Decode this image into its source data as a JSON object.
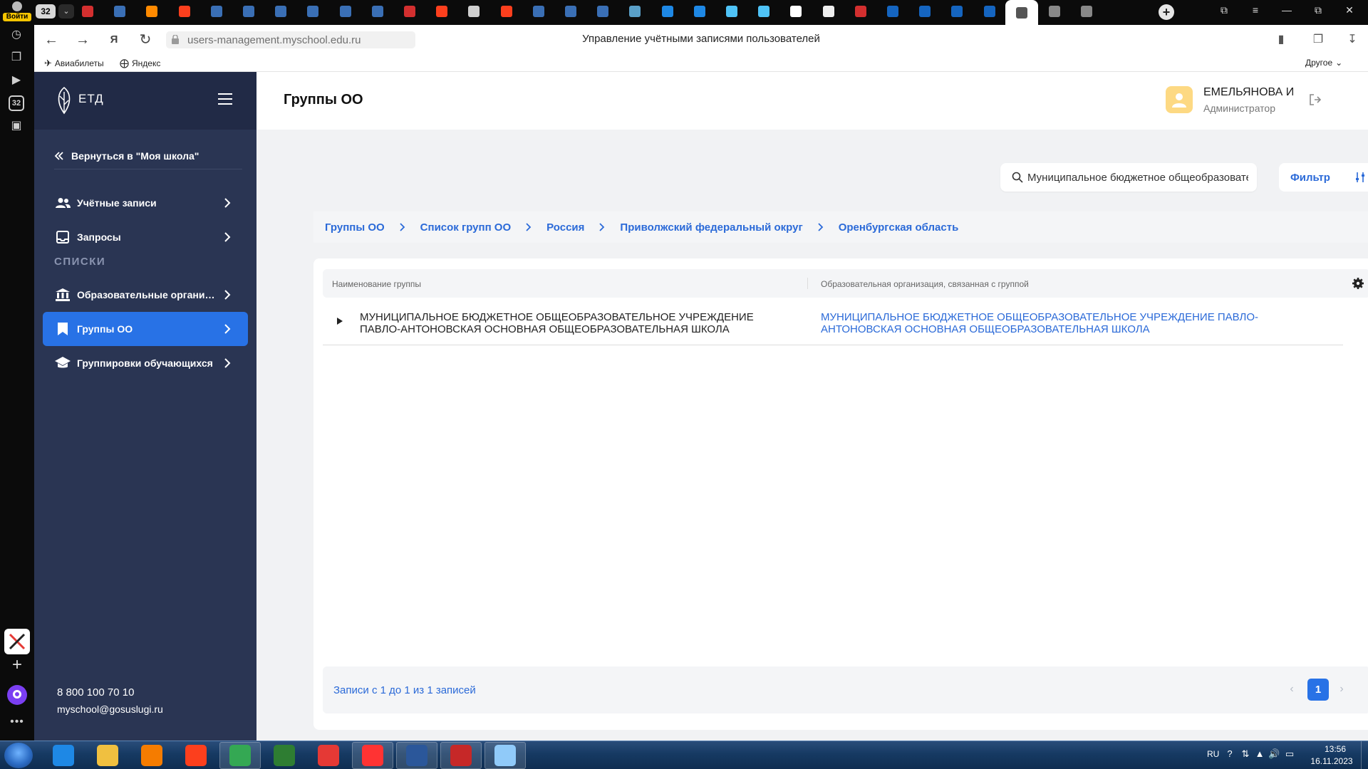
{
  "browser": {
    "login_label": "Войти",
    "tab_count": "32",
    "side_badge": "32",
    "tabs": [
      {
        "icon": "flag-ru-icon",
        "color": "#d32f2f"
      },
      {
        "icon": "emblem-icon",
        "color": "#3a6fb5"
      },
      {
        "icon": "cloud-icon",
        "color": "#ff8a00"
      },
      {
        "icon": "yandex-icon",
        "color": "#fc3f1d"
      },
      {
        "icon": "emblem-icon",
        "color": "#3a6fb5"
      },
      {
        "icon": "emblem-icon",
        "color": "#3a6fb5"
      },
      {
        "icon": "emblem-icon",
        "color": "#3a6fb5"
      },
      {
        "icon": "emblem-icon",
        "color": "#3a6fb5"
      },
      {
        "icon": "emblem-icon",
        "color": "#3a6fb5"
      },
      {
        "icon": "emblem-icon",
        "color": "#3a6fb5"
      },
      {
        "icon": "flag-ru-icon",
        "color": "#d32f2f"
      },
      {
        "icon": "yandex-icon",
        "color": "#fc3f1d"
      },
      {
        "icon": "signature-icon",
        "color": "#cfcfcf"
      },
      {
        "icon": "yandex-icon",
        "color": "#fc3f1d"
      },
      {
        "icon": "emblem-icon",
        "color": "#3a6fb5"
      },
      {
        "icon": "emblem-icon",
        "color": "#3a6fb5"
      },
      {
        "icon": "emblem-icon",
        "color": "#3a6fb5"
      },
      {
        "icon": "glasses-icon",
        "color": "#5aa0c8"
      },
      {
        "icon": "help-icon",
        "color": "#1e88e5"
      },
      {
        "icon": "help-icon",
        "color": "#1e88e5"
      },
      {
        "icon": "atom-icon",
        "color": "#4fc3f7"
      },
      {
        "icon": "atom-icon",
        "color": "#4fc3f7"
      },
      {
        "icon": "chat-icon",
        "color": "#ffffff"
      },
      {
        "icon": "document-icon",
        "color": "#eeeeee"
      },
      {
        "icon": "flag-ru-icon",
        "color": "#d32f2f"
      },
      {
        "icon": "mysh-icon",
        "color": "#1565c0"
      },
      {
        "icon": "mysh-icon",
        "color": "#1565c0"
      },
      {
        "icon": "mysh-icon",
        "color": "#1565c0"
      },
      {
        "icon": "mysh-icon",
        "color": "#1565c0"
      },
      {
        "icon": "etd-icon",
        "color": "#555555",
        "active": true
      },
      {
        "icon": "etd-icon",
        "color": "#888888"
      },
      {
        "icon": "etd-icon",
        "color": "#888888"
      }
    ],
    "url": "users-management.myschool.edu.ru",
    "page_title": "Управление учётными записями пользователей",
    "bookmarks": [
      {
        "label": "Авиабилеты",
        "icon": "plane-icon"
      },
      {
        "label": "Яндекс",
        "icon": "plus-circle-icon"
      }
    ],
    "other_bookmarks": "Другое"
  },
  "sidebar": {
    "logo_text": "ЕТД",
    "back_label": "Вернуться в \"Моя школа\"",
    "items_top": [
      {
        "label": "Учётные записи",
        "icon": "users-icon"
      },
      {
        "label": "Запросы",
        "icon": "inbox-icon"
      }
    ],
    "section_title": "СПИСКИ",
    "items_lists": [
      {
        "label": "Образовательные организации",
        "icon": "institution-icon"
      },
      {
        "label": "Группы ОО",
        "icon": "bookmark-icon",
        "active": true
      },
      {
        "label": "Группировки обучающихся",
        "icon": "graduation-cap-icon"
      }
    ],
    "phone": "8 800 100 70 10",
    "email": "myschool@gosuslugi.ru"
  },
  "header": {
    "title": "Группы ОО",
    "user_name": "ЕМЕЛЬЯНОВА И",
    "user_role": "Администратор"
  },
  "search": {
    "value": "Муниципальное бюджетное общеобразовательное учреждение Павло-Антоновская"
  },
  "filter": {
    "label": "Фильтр"
  },
  "breadcrumb": [
    "Группы ОО",
    "Список групп ОО",
    "Россия",
    "Приволжский федеральный округ",
    "Оренбургская область"
  ],
  "table": {
    "columns": [
      "Наименование группы",
      "Образовательная организация, связанная с группой"
    ],
    "rows": [
      {
        "name": "МУНИЦИПАЛЬНОЕ БЮДЖЕТНОЕ ОБЩЕОБРАЗОВАТЕЛЬНОЕ УЧРЕЖДЕНИЕ ПАВЛО-АНТОНОВСКАЯ ОСНОВНАЯ ОБЩЕОБРАЗОВАТЕЛЬНАЯ ШКОЛА",
        "organization": "МУНИЦИПАЛЬНОЕ БЮДЖЕТНОЕ ОБЩЕОБРАЗОВАТЕЛЬНОЕ УЧРЕЖДЕНИЕ ПАВЛО-АНТОНОВСКАЯ ОСНОВНАЯ ОБЩЕОБРАЗОВАТЕЛЬНАЯ ШКОЛА"
      }
    ]
  },
  "pagination": {
    "records_info": "Записи с 1 до 1 из 1 записей",
    "current_page": "1"
  },
  "taskbar": {
    "apps": [
      {
        "name": "internet-explorer",
        "color": "#1e88e5"
      },
      {
        "name": "file-explorer",
        "color": "#f0c040"
      },
      {
        "name": "media-player",
        "color": "#f57c00"
      },
      {
        "name": "yandex",
        "color": "#fc3f1d"
      },
      {
        "name": "chrome",
        "color": "#34a853",
        "running": true
      },
      {
        "name": "kenya-app",
        "color": "#2e7d32"
      },
      {
        "name": "opera",
        "color": "#e53935"
      },
      {
        "name": "yandex-browser",
        "color": "#ff3333",
        "running": true
      },
      {
        "name": "word",
        "color": "#2b579a",
        "running": true
      },
      {
        "name": "red-app",
        "color": "#c62828",
        "running": true
      },
      {
        "name": "paint",
        "color": "#90caf9",
        "running": true
      }
    ],
    "lang": "RU",
    "time": "13:56",
    "date": "16.11.2023"
  },
  "colors": {
    "sidebar": "#2a3553",
    "accent": "#2872e6",
    "link": "#2b6ad8"
  }
}
